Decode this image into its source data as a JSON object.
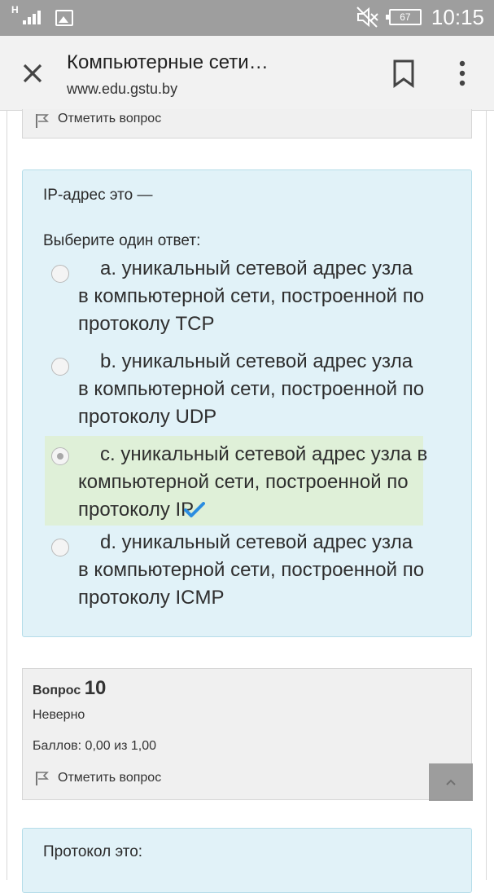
{
  "status_bar": {
    "network_type": "H",
    "battery_level": "67",
    "time": "10:15"
  },
  "header": {
    "title": "Компьютерные сети…",
    "url": "www.edu.gstu.by"
  },
  "prev_question": {
    "flag_label": "Отметить вопрос"
  },
  "question": {
    "text": "IP-адрес это —",
    "prompt": "Выберите один ответ:",
    "answers": [
      {
        "label": "a. уникальный сетевой адрес узла в компьютерной сети, построенной по протоколу TCP",
        "selected": false,
        "correct": false
      },
      {
        "label": "b. уникальный сетевой адрес узла в компьютерной сети, построенной по протоколу UDP",
        "selected": false,
        "correct": false
      },
      {
        "label": "c. уникальный сетевой адрес узла в компьютерной сети, построенной по протоколу IP",
        "selected": true,
        "correct": true
      },
      {
        "label": "d. уникальный сетевой адрес узла в компьютерной сети, построенной по протоколу ICMP",
        "selected": false,
        "correct": false
      }
    ]
  },
  "question_info": {
    "word": "Вопрос",
    "number": "10",
    "status": "Неверно",
    "score": "Баллов: 0,00 из 1,00",
    "flag_label": "Отметить вопрос"
  },
  "next_question": {
    "text": "Протокол это:"
  },
  "colors": {
    "question_bg": "#e1f2f8",
    "correct_bg": "#dff0d8",
    "tick": "#2b8de0",
    "info_bg": "#f0f0f0"
  }
}
